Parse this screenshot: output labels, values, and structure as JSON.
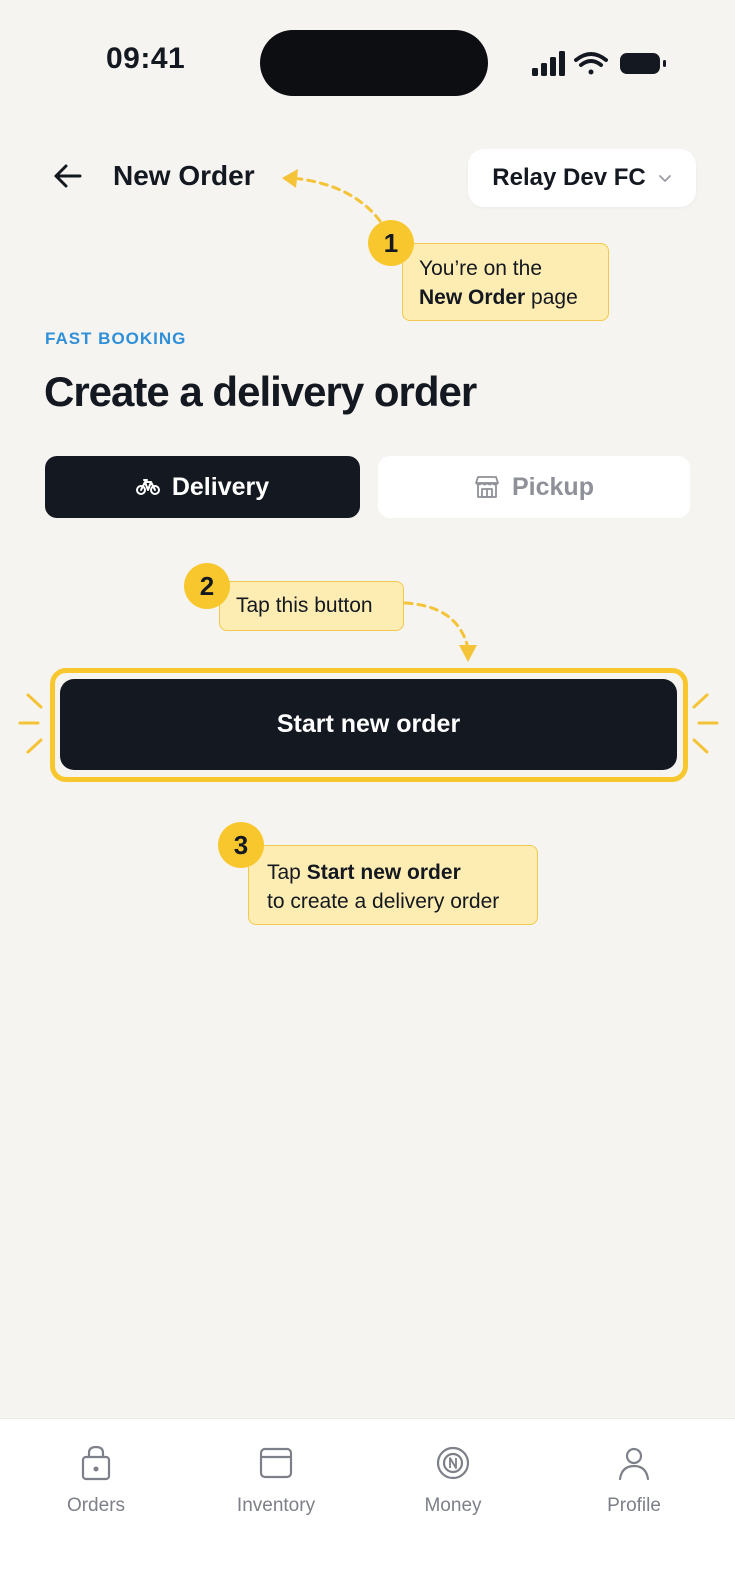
{
  "status_bar": {
    "time": "09:41"
  },
  "header": {
    "title": "New Order",
    "org_selector": "Relay Dev FC"
  },
  "main": {
    "eyebrow": "FAST BOOKING",
    "heading": "Create a delivery order",
    "segments": [
      {
        "label": "Delivery",
        "icon": "bicycle-icon",
        "selected": true
      },
      {
        "label": "Pickup",
        "icon": "store-icon",
        "selected": false
      }
    ],
    "primary_button": "Start new order"
  },
  "annotations": [
    {
      "number": "1",
      "text_before": "You’re on the",
      "bold": "New Order",
      "text_after": " page"
    },
    {
      "number": "2",
      "text": "Tap this button"
    },
    {
      "number": "3",
      "text_before": "Tap ",
      "bold": "Start new order",
      "text_after": "to create a delivery order"
    }
  ],
  "bottom_nav": [
    {
      "label": "Orders",
      "icon": "lock-bag-icon"
    },
    {
      "label": "Inventory",
      "icon": "inventory-icon"
    },
    {
      "label": "Money",
      "icon": "coin-icon"
    },
    {
      "label": "Profile",
      "icon": "person-icon"
    }
  ],
  "colors": {
    "background": "#f5f4f1",
    "primary": "#141820",
    "accent_yellow": "#f8c72e",
    "callout_fill": "#fdedb3",
    "eyebrow_blue": "#2f8fd8"
  }
}
